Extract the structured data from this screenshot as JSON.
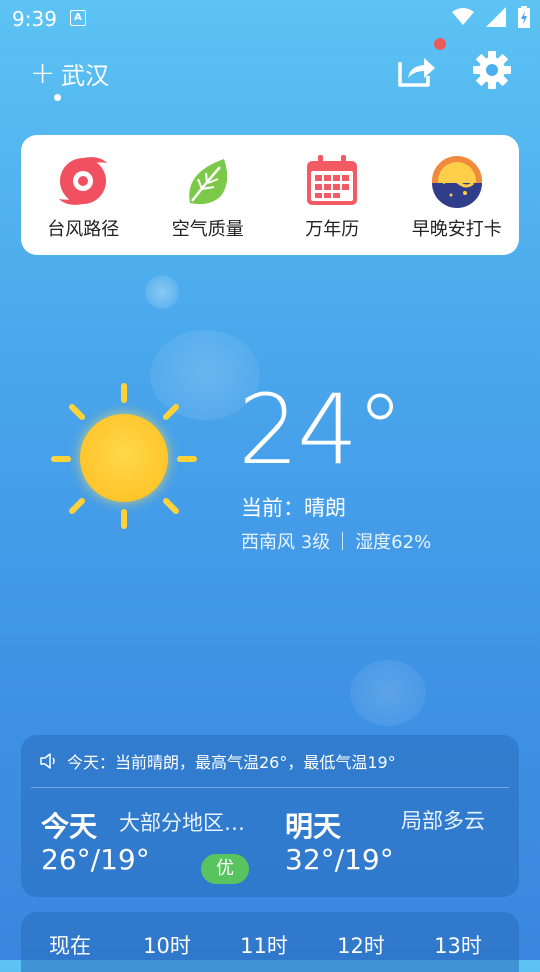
{
  "status_bar": {
    "time": "9:39",
    "notification_letter": "A"
  },
  "header": {
    "city": "武汉"
  },
  "tools": [
    {
      "label": "台风路径",
      "icon": "typhoon-icon"
    },
    {
      "label": "空气质量",
      "icon": "leaf-icon"
    },
    {
      "label": "万年历",
      "icon": "calendar-icon"
    },
    {
      "label": "早晚安打卡",
      "icon": "sunrise-icon"
    }
  ],
  "current": {
    "temperature": "24°",
    "condition": "当前：晴朗",
    "wind": "西南风 3级",
    "humidity": "湿度62%"
  },
  "forecast": {
    "notice": "今天：当前晴朗，最高气温26°，最低气温19°",
    "today": {
      "title": "今天",
      "desc": "大部分地区…",
      "range": "26°/19°",
      "aqi": "优"
    },
    "tomorrow": {
      "title": "明天",
      "desc": "局部多云",
      "range": "32°/19°"
    }
  },
  "hourly": [
    "现在",
    "10时",
    "11时",
    "12时",
    "13时"
  ],
  "colors": {
    "accent_red": "#e95a5a",
    "aqi_good": "#57c45f",
    "sun": "#ffd23a"
  }
}
